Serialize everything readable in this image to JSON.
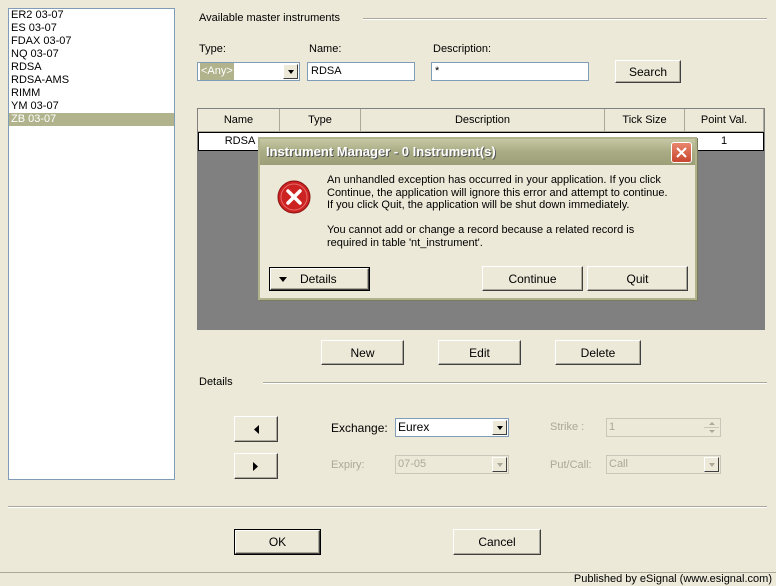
{
  "instruments": [
    "ER2 03-07",
    "ES 03-07",
    "FDAX 03-07",
    "NQ 03-07",
    "RDSA",
    "RDSA-AMS",
    "RIMM",
    "YM 03-07",
    "ZB 03-07"
  ],
  "selected_instrument": "ZB 03-07",
  "search": {
    "group_label": "Available master instruments",
    "type_label": "Type:",
    "type_value": "<Any>",
    "name_label": "Name:",
    "name_value": "RDSA",
    "description_label": "Description:",
    "description_value": "*",
    "search_button": "Search"
  },
  "grid": {
    "columns": [
      "Name",
      "Type",
      "Description",
      "Tick Size",
      "Point Val."
    ],
    "rows": [
      {
        "name": "RDSA",
        "type": "",
        "description": "",
        "tick_size": "",
        "point_val": "1"
      }
    ]
  },
  "actions": {
    "new": "New",
    "edit": "Edit",
    "delete": "Delete"
  },
  "details": {
    "label": "Details",
    "exchange_label": "Exchange:",
    "exchange_value": "Eurex",
    "expiry_label": "Expiry:",
    "expiry_value": "07-05",
    "strike_label": "Strike :",
    "strike_value": "1",
    "putcall_label": "Put/Call:",
    "putcall_value": "Call"
  },
  "footer": {
    "ok": "OK",
    "cancel": "Cancel"
  },
  "dialog": {
    "title": "Instrument Manager - 0 Instrument(s)",
    "message_lines": [
      "An unhandled exception has occurred in your application. If you click",
      "Continue, the application will ignore this error and attempt to continue.",
      "If you click Quit, the application will be shut down immediately."
    ],
    "detail_lines": [
      "You cannot add or change a record because a related record is",
      "required in table 'nt_instrument'."
    ],
    "details_button": "Details",
    "continue_button": "Continue",
    "quit_button": "Quit",
    "icon": "error-icon"
  },
  "publisher": "Published by eSignal (www.esignal.com)",
  "colors": {
    "selection": "#b0b38c",
    "window_bg": "#ece9d8",
    "error_red": "#cc2222"
  }
}
